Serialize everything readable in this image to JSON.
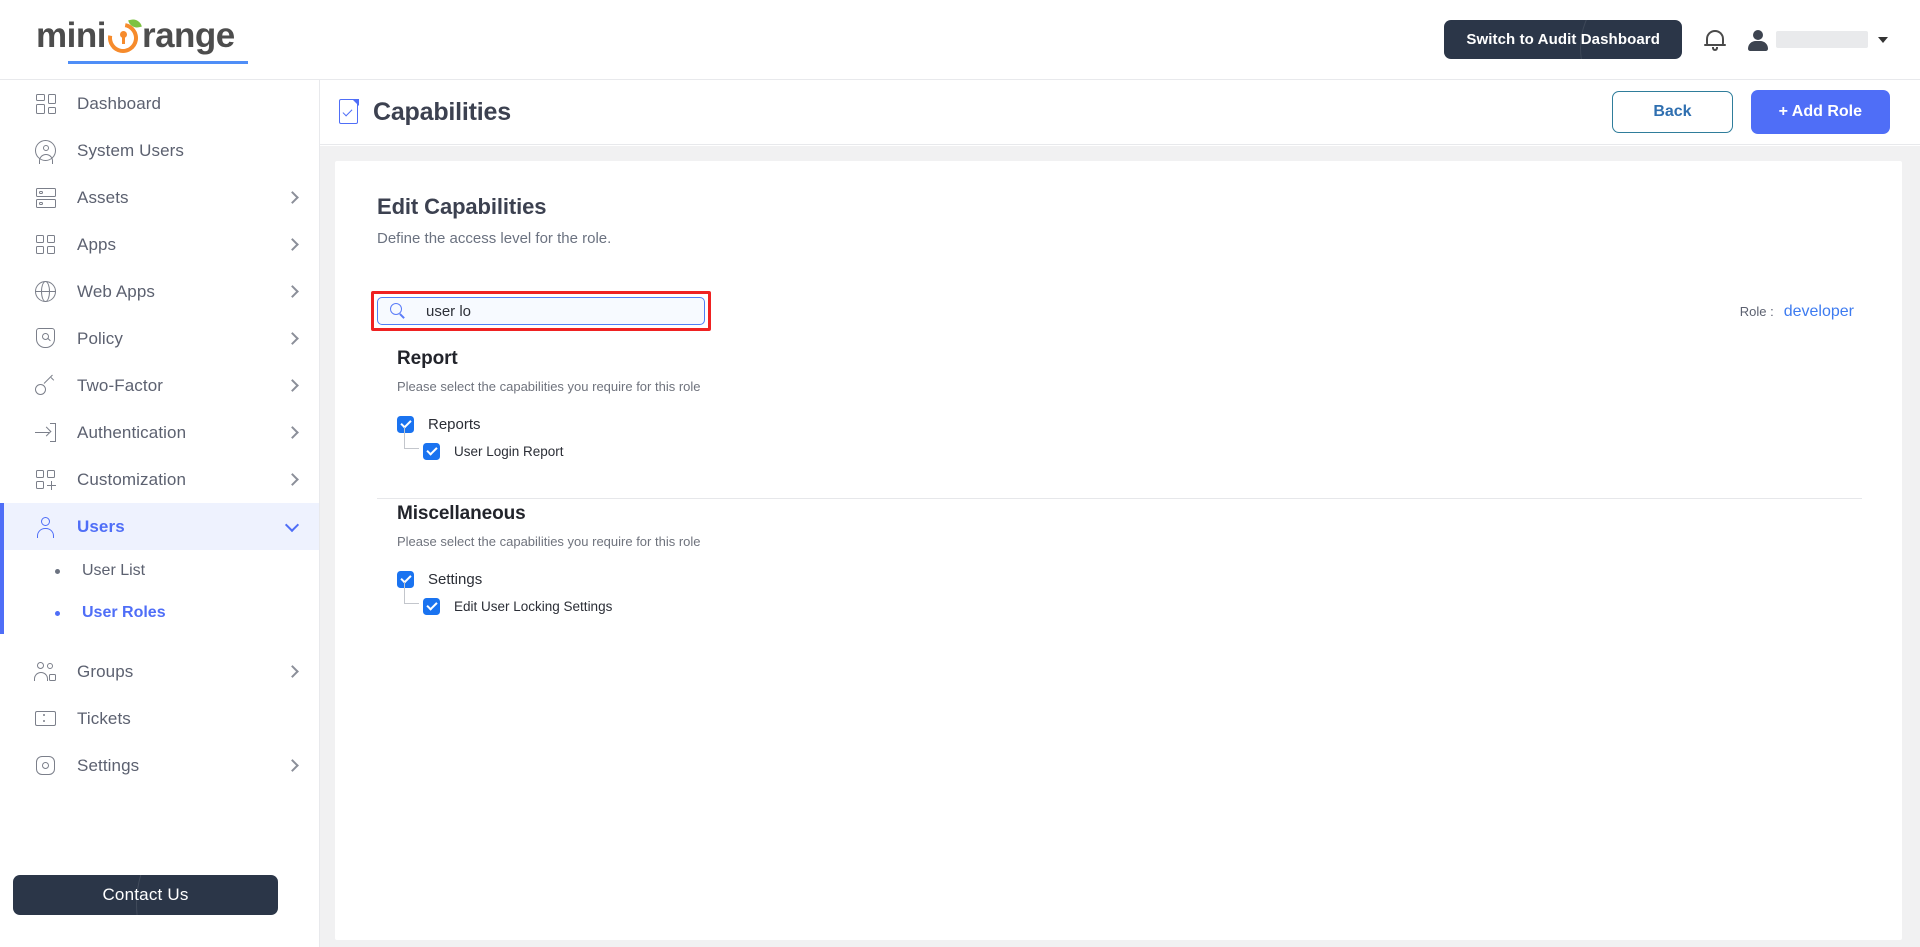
{
  "brand": {
    "name_part1": "mini",
    "name_part2": "range",
    "logo_mark_icon": "orange-keyhole-icon",
    "accent_orange": "#f68b2c",
    "accent_green": "#7dc242",
    "accent_blue": "#4f6ef7"
  },
  "topbar": {
    "audit_button": "Switch to Audit Dashboard",
    "bell_icon": "notification-bell-icon",
    "avatar_icon": "user-avatar-icon",
    "user_name": "",
    "caret_icon": "chevron-down-icon"
  },
  "sidebar": {
    "items": [
      {
        "label": "Dashboard",
        "icon": "dashboard-grid-icon",
        "has_chevron": false,
        "active": false
      },
      {
        "label": "System Users",
        "icon": "user-circle-icon",
        "has_chevron": false,
        "active": false
      },
      {
        "label": "Assets",
        "icon": "server-stack-icon",
        "has_chevron": true,
        "active": false
      },
      {
        "label": "Apps",
        "icon": "apps-grid-icon",
        "has_chevron": true,
        "active": false
      },
      {
        "label": "Web Apps",
        "icon": "globe-icon",
        "has_chevron": true,
        "active": false
      },
      {
        "label": "Policy",
        "icon": "shield-search-icon",
        "has_chevron": true,
        "active": false
      },
      {
        "label": "Two-Factor",
        "icon": "key-icon",
        "has_chevron": true,
        "active": false
      },
      {
        "label": "Authentication",
        "icon": "login-arrow-icon",
        "has_chevron": true,
        "active": false
      },
      {
        "label": "Customization",
        "icon": "grid-plus-icon",
        "has_chevron": true,
        "active": false
      },
      {
        "label": "Users",
        "icon": "person-icon",
        "has_chevron": true,
        "active": true
      },
      {
        "label": "Groups",
        "icon": "people-group-icon",
        "has_chevron": true,
        "active": false
      },
      {
        "label": "Tickets",
        "icon": "ticket-icon",
        "has_chevron": false,
        "active": false
      },
      {
        "label": "Settings",
        "icon": "gear-icon",
        "has_chevron": true,
        "active": false
      }
    ],
    "sub_items": [
      {
        "label": "User List",
        "selected": false
      },
      {
        "label": "User Roles",
        "selected": true
      }
    ],
    "contact_button": "Contact Us"
  },
  "page": {
    "title": "Capabilities",
    "title_icon": "document-check-icon",
    "back_button": "Back",
    "add_role_button": "+ Add Role"
  },
  "card": {
    "heading": "Edit Capabilities",
    "subheading": "Define the access level for the role.",
    "search": {
      "icon": "search-icon",
      "value": "user lo",
      "placeholder": "Search",
      "highlight_color": "#ef2222"
    },
    "role": {
      "label": "Role :",
      "value": "developer"
    },
    "sections": [
      {
        "title": "Report",
        "note": "Please select the capabilities you require for this role",
        "capabilities": [
          {
            "label": "Reports",
            "checked": true,
            "child": false
          },
          {
            "label": "User Login Report",
            "checked": true,
            "child": true
          }
        ]
      },
      {
        "title": "Miscellaneous",
        "note": "Please select the capabilities you require for this role",
        "capabilities": [
          {
            "label": "Settings",
            "checked": true,
            "child": false
          },
          {
            "label": "Edit User Locking Settings",
            "checked": true,
            "child": true
          }
        ]
      }
    ]
  }
}
